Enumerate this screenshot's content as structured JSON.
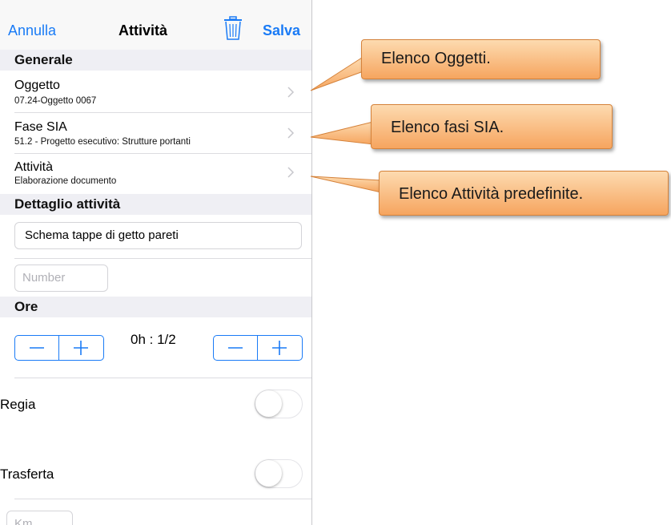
{
  "navbar": {
    "cancel_label": "Annulla",
    "title": "Attività",
    "save_label": "Salva",
    "trash_icon": "trash-icon",
    "accent_color": "#1a7bf6"
  },
  "sections": {
    "general": "Generale",
    "activity_detail": "Dettaglio attività",
    "hours": "Ore"
  },
  "general_rows": [
    {
      "title": "Oggetto",
      "subtitle": "07.24-Oggetto 0067"
    },
    {
      "title": "Fase SIA",
      "subtitle": "51.2 - Progetto esecutivo: Strutture portanti"
    },
    {
      "title": "Attività",
      "subtitle": "Elaborazione documento"
    }
  ],
  "detail": {
    "description_value": "Schema tappe di getto pareti",
    "number_placeholder": "Number"
  },
  "hours": {
    "value": "0h : 1/2"
  },
  "toggles": {
    "regia_label": "Regia",
    "regia_on": false,
    "trasferta_label": "Trasferta",
    "trasferta_on": false,
    "km_placeholder": "Km"
  },
  "callouts": [
    {
      "text": "Elenco Oggetti."
    },
    {
      "text": "Elenco fasi SIA."
    },
    {
      "text": "Elenco Attività predefinite."
    }
  ],
  "callout_colors": {
    "fill_top": "#fddbb0",
    "fill_bottom": "#f6a55f",
    "border": "#d5823a"
  }
}
